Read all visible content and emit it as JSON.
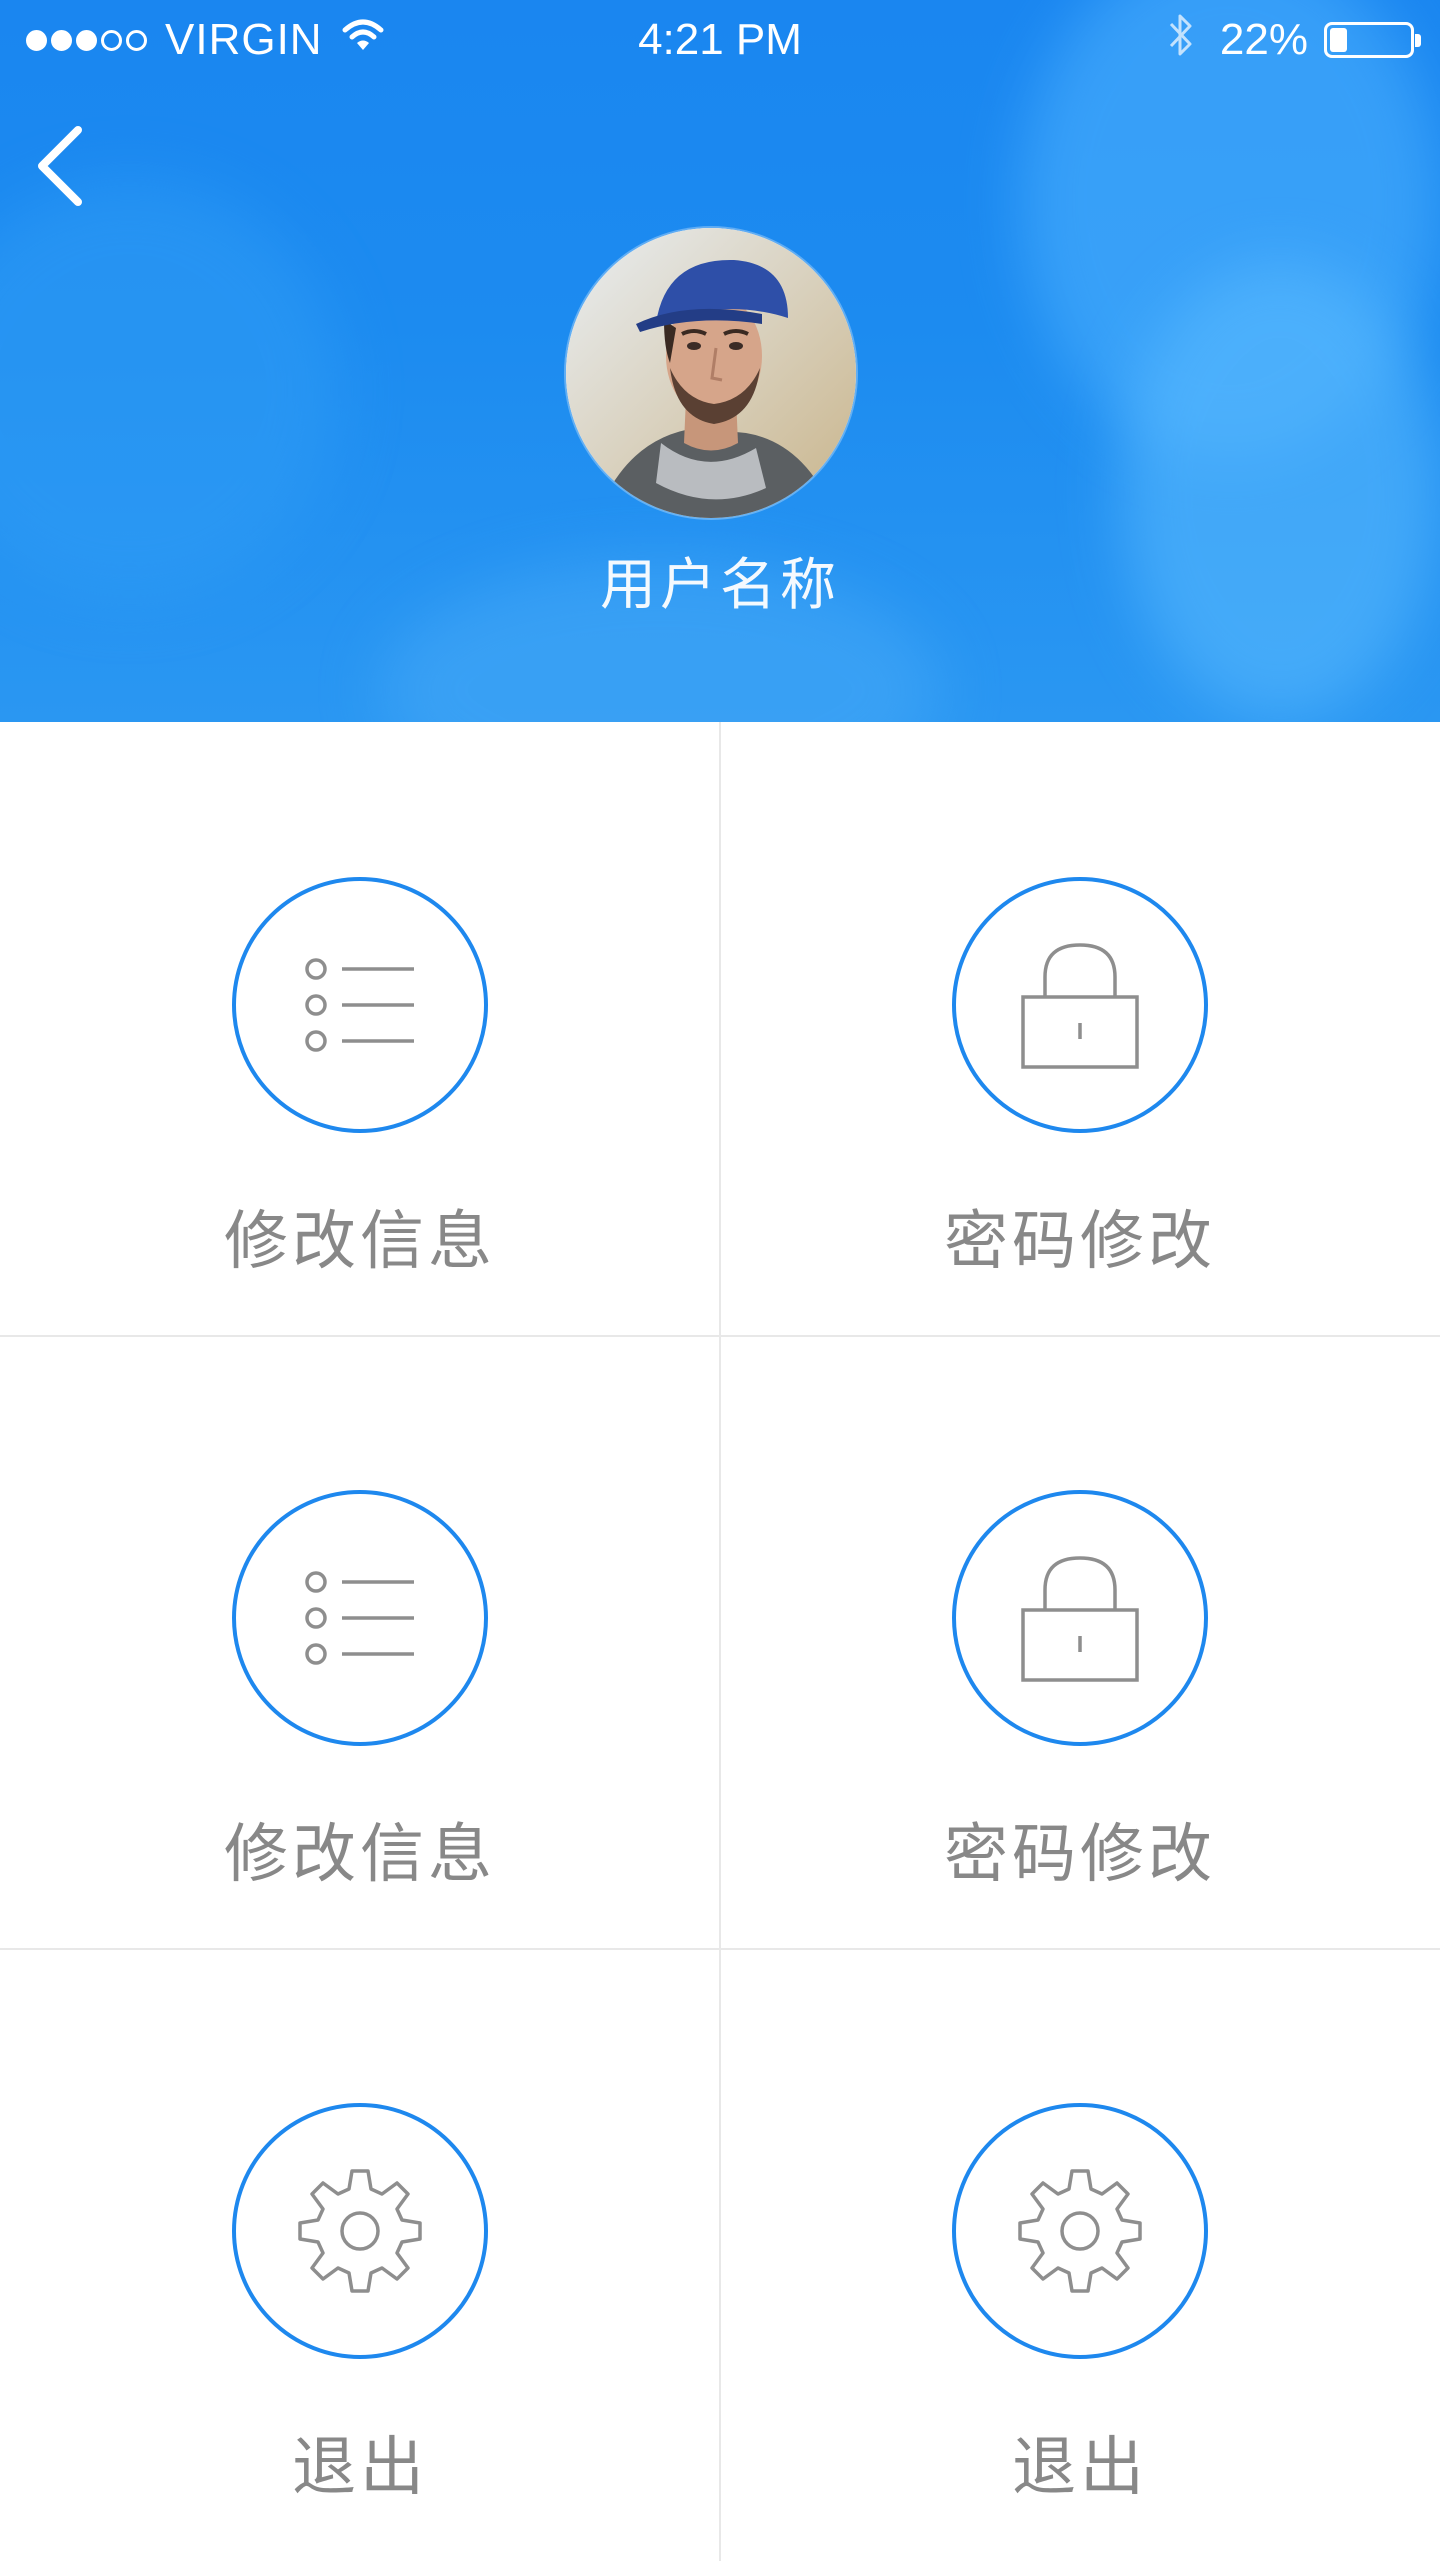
{
  "status_bar": {
    "signal_filled": 3,
    "signal_total": 5,
    "carrier": "VIRGIN",
    "time": "4:21 PM",
    "battery_percent_text": "22%",
    "battery_level": 0.22,
    "icons": [
      "wifi-icon",
      "bluetooth-icon",
      "battery-icon"
    ]
  },
  "header": {
    "background_color": "#1a86f0",
    "back_icon": "chevron-left-icon",
    "user_name": "用户名称"
  },
  "accent_color": "#1e88ee",
  "icon_color": "#8e8e8e",
  "grid": {
    "tiles": [
      {
        "label": "修改信息",
        "icon": "list-icon"
      },
      {
        "label": "密码修改",
        "icon": "lock-icon"
      },
      {
        "label": "修改信息",
        "icon": "list-icon"
      },
      {
        "label": "密码修改",
        "icon": "lock-icon"
      },
      {
        "label": "退出",
        "icon": "gear-icon"
      },
      {
        "label": "退出",
        "icon": "gear-icon"
      }
    ]
  }
}
